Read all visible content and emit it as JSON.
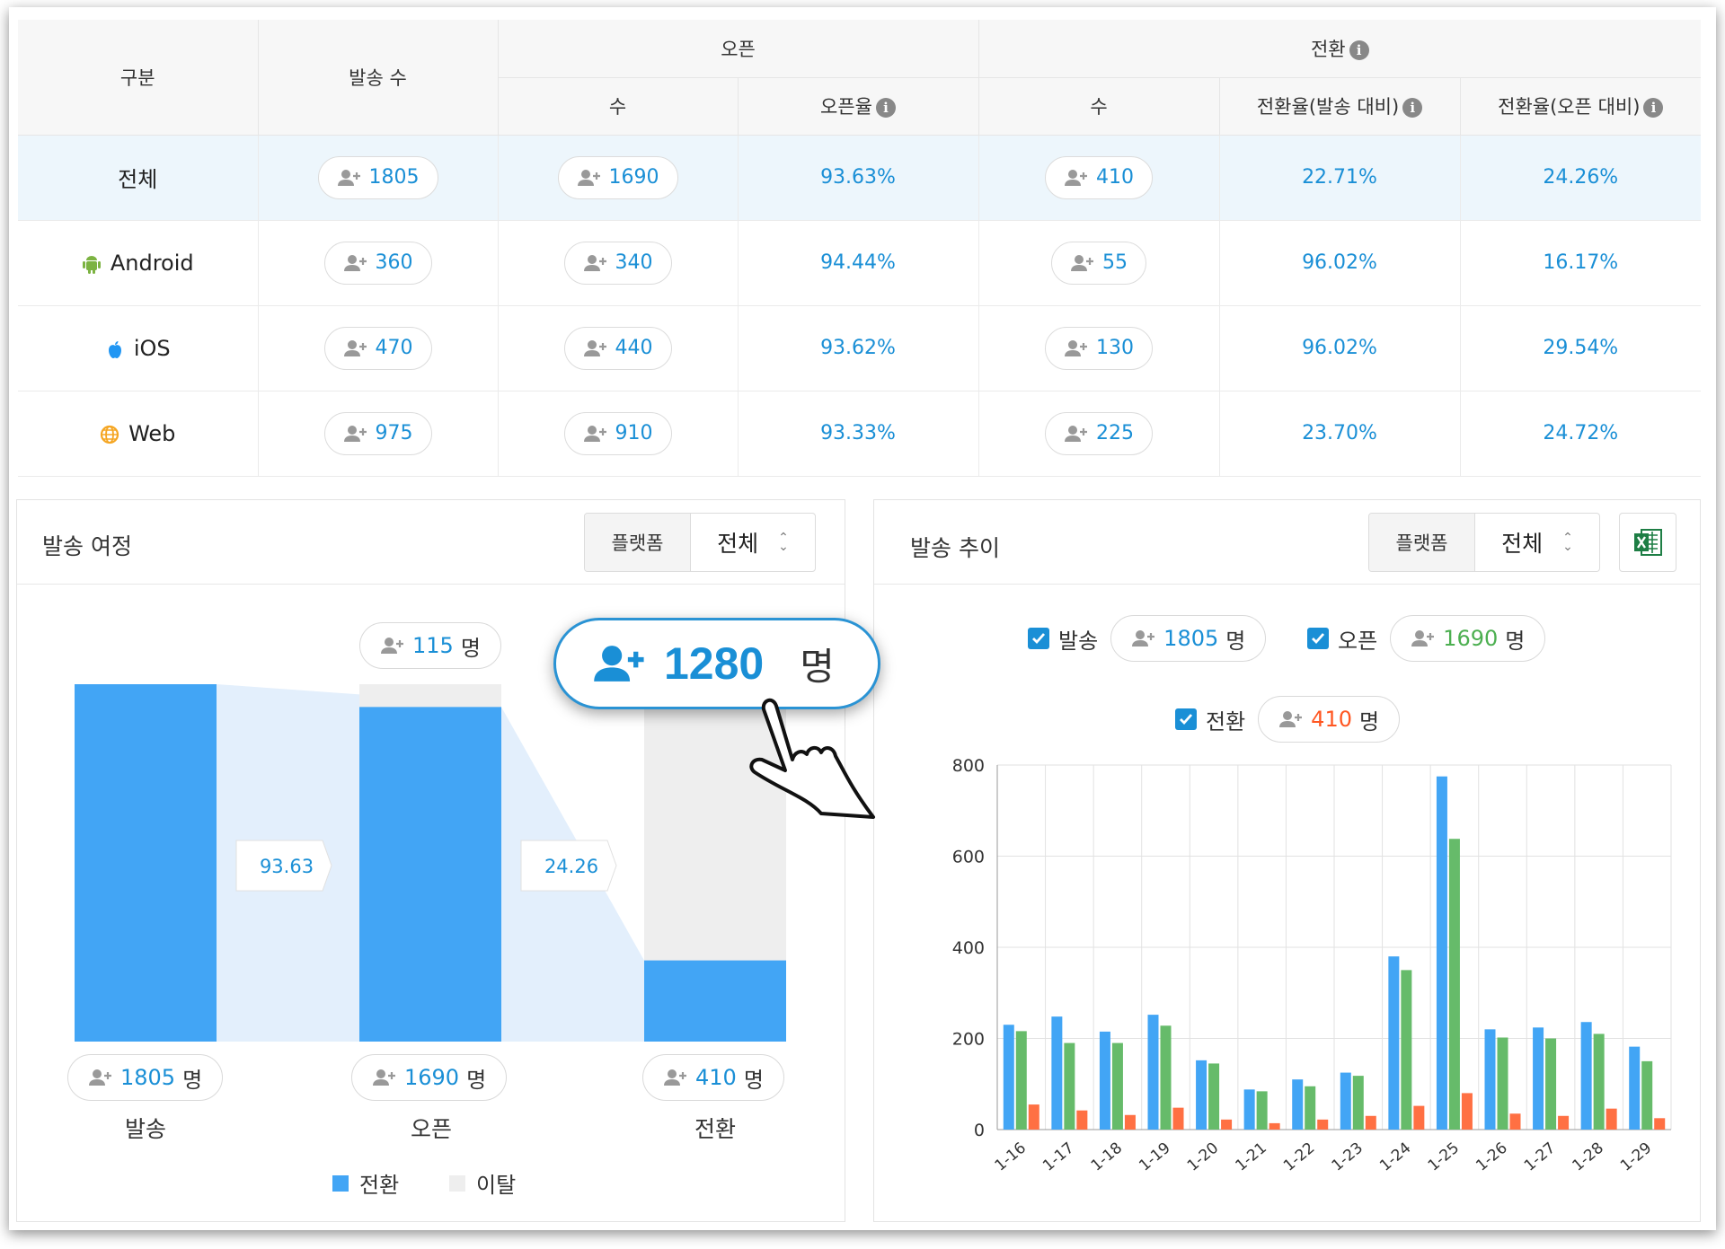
{
  "table": {
    "headers": {
      "category": "구분",
      "sent": "발송 수",
      "open_group": "오픈",
      "conv_group": "전환",
      "open_count": "수",
      "open_rate": "오픈율",
      "conv_count": "수",
      "conv_rate_sent": "전환율(발송 대비)",
      "conv_rate_open": "전환율(오픈 대비)"
    },
    "rows": [
      {
        "label": "전체",
        "platform": "total",
        "sent": "1805",
        "open": "1690",
        "open_rate": "93.63%",
        "conv": "410",
        "conv_rate_sent": "22.71%",
        "conv_rate_open": "24.26%"
      },
      {
        "label": "Android",
        "platform": "android-icon",
        "sent": "360",
        "open": "340",
        "open_rate": "94.44%",
        "conv": "55",
        "conv_rate_sent": "96.02%",
        "conv_rate_open": "16.17%"
      },
      {
        "label": "iOS",
        "platform": "apple-icon",
        "sent": "470",
        "open": "440",
        "open_rate": "93.62%",
        "conv": "130",
        "conv_rate_sent": "96.02%",
        "conv_rate_open": "29.54%"
      },
      {
        "label": "Web",
        "platform": "globe-icon",
        "sent": "975",
        "open": "910",
        "open_rate": "93.33%",
        "conv": "225",
        "conv_rate_sent": "23.70%",
        "conv_rate_open": "24.72%"
      }
    ]
  },
  "journey": {
    "title": "발송 여정",
    "platform_label": "플랫폼",
    "platform_value": "전체",
    "drop_bubble": {
      "value": "115",
      "unit": "명"
    },
    "rate1": "93.63",
    "rate2": "24.26",
    "stages": [
      {
        "label": "발송",
        "value": "1805",
        "unit": "명",
        "total": 1805,
        "kept": 1805
      },
      {
        "label": "오픈",
        "value": "1690",
        "unit": "명",
        "total": 1805,
        "kept": 1690
      },
      {
        "label": "전환",
        "value": "410",
        "unit": "명",
        "total": 1690,
        "kept": 410
      }
    ],
    "legend": {
      "kept": "전환",
      "dropped": "이탈"
    },
    "colors": {
      "kept": "#42a5f5",
      "dropped": "#eeeeee",
      "flow": "#e3effc"
    }
  },
  "callout": {
    "value": "1280",
    "unit": "명"
  },
  "trend": {
    "title": "발송 추이",
    "platform_label": "플랫폼",
    "platform_value": "전체",
    "excel_icon": "excel-icon",
    "toggles": [
      {
        "label": "발송",
        "value": "1805",
        "unit": "명",
        "color": "#1a8fd6"
      },
      {
        "label": "오픈",
        "value": "1690",
        "unit": "명",
        "color": "#4caf50"
      },
      {
        "label": "전환",
        "value": "410",
        "unit": "명",
        "color": "#ff5722"
      }
    ]
  },
  "chart_data": {
    "type": "bar",
    "categories": [
      "1-16",
      "1-17",
      "1-18",
      "1-19",
      "1-20",
      "1-21",
      "1-22",
      "1-23",
      "1-24",
      "1-25",
      "1-26",
      "1-27",
      "1-28",
      "1-29"
    ],
    "series": [
      {
        "name": "발송",
        "color": "#42a5f5",
        "values": [
          230,
          248,
          215,
          252,
          152,
          88,
          110,
          125,
          380,
          775,
          220,
          224,
          236,
          182
        ]
      },
      {
        "name": "오픈",
        "color": "#66bb6a",
        "values": [
          216,
          190,
          190,
          228,
          145,
          84,
          95,
          118,
          350,
          638,
          202,
          200,
          210,
          150
        ]
      },
      {
        "name": "전환",
        "color": "#ff7043",
        "values": [
          55,
          42,
          32,
          48,
          22,
          14,
          22,
          30,
          52,
          80,
          35,
          30,
          46,
          25
        ]
      }
    ],
    "ylim": [
      0,
      800
    ],
    "yticks": [
      "0",
      "200",
      "400",
      "600",
      "800"
    ],
    "grid": true
  }
}
